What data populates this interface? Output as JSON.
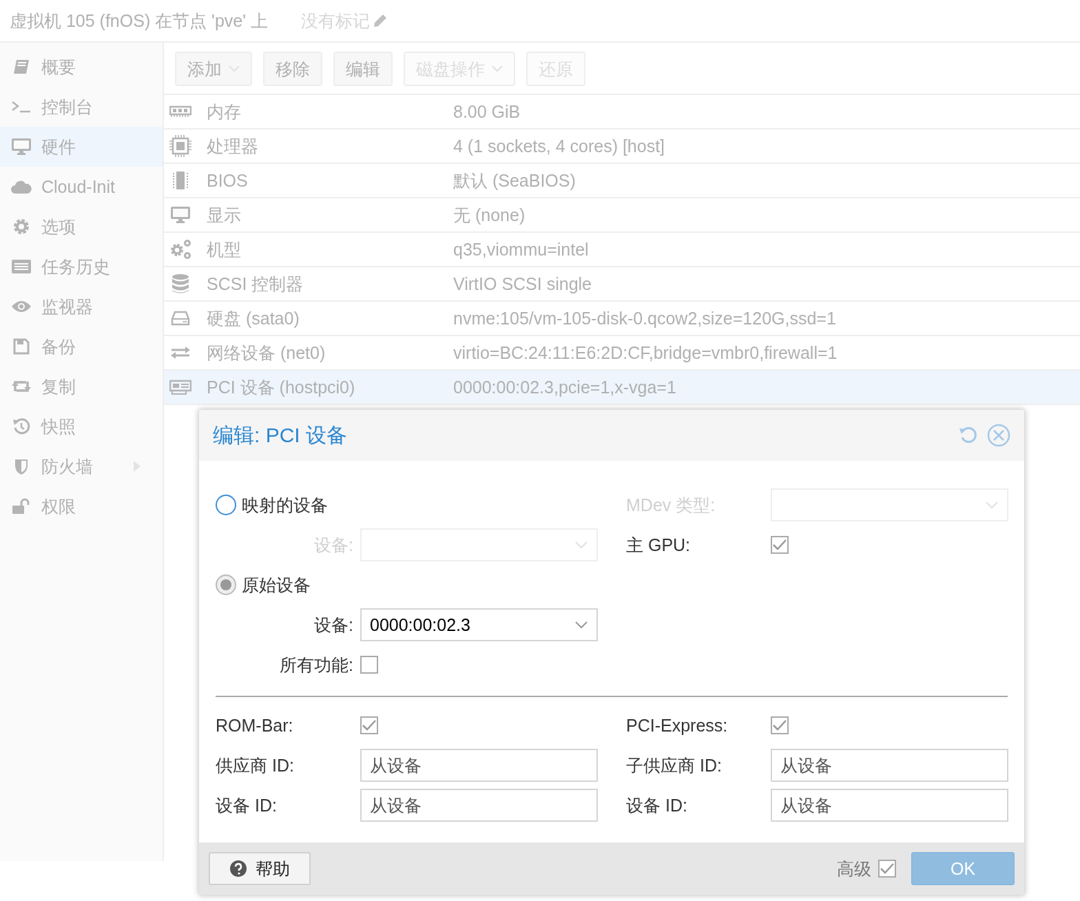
{
  "header": {
    "title": "虚拟机 105 (fnOS) 在节点 'pve' 上",
    "tags": "没有标记"
  },
  "sidebar": {
    "items": [
      {
        "label": "概要",
        "selected": false,
        "has_submenu": false
      },
      {
        "label": "控制台",
        "selected": false,
        "has_submenu": false
      },
      {
        "label": "硬件",
        "selected": true,
        "has_submenu": false
      },
      {
        "label": "Cloud-Init",
        "selected": false,
        "has_submenu": false
      },
      {
        "label": "选项",
        "selected": false,
        "has_submenu": false
      },
      {
        "label": "任务历史",
        "selected": false,
        "has_submenu": false
      },
      {
        "label": "监视器",
        "selected": false,
        "has_submenu": false
      },
      {
        "label": "备份",
        "selected": false,
        "has_submenu": false
      },
      {
        "label": "复制",
        "selected": false,
        "has_submenu": false
      },
      {
        "label": "快照",
        "selected": false,
        "has_submenu": false
      },
      {
        "label": "防火墙",
        "selected": false,
        "has_submenu": true
      },
      {
        "label": "权限",
        "selected": false,
        "has_submenu": false
      }
    ]
  },
  "toolbar": [
    {
      "label": "添加",
      "menu": true,
      "disabled": false
    },
    {
      "label": "移除",
      "menu": false,
      "disabled": false
    },
    {
      "label": "编辑",
      "menu": false,
      "disabled": false
    },
    {
      "label": "磁盘操作",
      "menu": true,
      "disabled": true
    },
    {
      "label": "还原",
      "menu": false,
      "disabled": true
    }
  ],
  "hardware": [
    {
      "name": "内存",
      "value": "8.00 GiB",
      "selected": false
    },
    {
      "name": "处理器",
      "value": "4 (1 sockets, 4 cores) [host]",
      "selected": false
    },
    {
      "name": "BIOS",
      "value": "默认 (SeaBIOS)",
      "selected": false
    },
    {
      "name": "显示",
      "value": "无 (none)",
      "selected": false
    },
    {
      "name": "机型",
      "value": "q35,viommu=intel",
      "selected": false
    },
    {
      "name": "SCSI 控制器",
      "value": "VirtIO SCSI single",
      "selected": false
    },
    {
      "name": "硬盘 (sata0)",
      "value": "nvme:105/vm-105-disk-0.qcow2,size=120G,ssd=1",
      "selected": false
    },
    {
      "name": "网络设备 (net0)",
      "value": "virtio=BC:24:11:E6:2D:CF,bridge=vmbr0,firewall=1",
      "selected": false
    },
    {
      "name": "PCI 设备 (hostpci0)",
      "value": "0000:00:02.3,pcie=1,x-vga=1",
      "selected": true
    }
  ],
  "dialog": {
    "title": "编辑: PCI 设备",
    "top_left": [
      {
        "kind": "radio",
        "label": "映射的设备",
        "selected": false
      },
      {
        "kind": "combo",
        "label": "设备:",
        "disabled": true
      },
      {
        "kind": "radio",
        "label": "原始设备",
        "selected": true
      },
      {
        "kind": "combo",
        "label": "设备:",
        "value": "0000:00:02.3",
        "disabled": false
      },
      {
        "kind": "checkbox",
        "label": "所有功能:",
        "checked": false
      }
    ],
    "top_right": [
      {
        "kind": "combo",
        "label": "MDev 类型:",
        "disabled": true
      },
      {
        "kind": "checkbox",
        "label": "主 GPU:",
        "checked": true
      }
    ],
    "bottom_left": [
      {
        "kind": "checkbox",
        "label": "ROM-Bar:",
        "checked": true
      },
      {
        "kind": "text",
        "label": "供应商 ID:",
        "placeholder": "从设备"
      },
      {
        "kind": "text",
        "label": "设备 ID:",
        "placeholder": "从设备"
      }
    ],
    "bottom_right": [
      {
        "kind": "checkbox",
        "label": "PCI-Express:",
        "checked": true
      },
      {
        "kind": "text",
        "label": "子供应商 ID:",
        "placeholder": "从设备"
      },
      {
        "kind": "text",
        "label": "设备 ID:",
        "placeholder": "从设备"
      }
    ],
    "help_button": "帮助",
    "advanced": {
      "label": "高级",
      "checked": true
    },
    "ok_button": "OK"
  }
}
